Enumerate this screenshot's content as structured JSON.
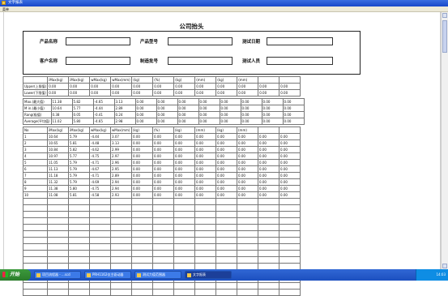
{
  "window": {
    "title": "文字报表"
  },
  "menu": {
    "item": "菜单"
  },
  "report": {
    "company_title": "公司抬头"
  },
  "form": {
    "product_name": "产品名称",
    "product_model": "产品型号",
    "test_date": "测试日期",
    "customer_name": "客户名称",
    "batch_no": "制造批号",
    "tester": "测试人员"
  },
  "header_row": [
    "",
    "iMax(kg)",
    "iMax(kg)",
    "wMax(kg)",
    "wMax(mm)",
    "(kg)",
    "(%)",
    "(kg)",
    "(mm)",
    "(kg)",
    "(mm)",
    "",
    ""
  ],
  "limit_rows": [
    [
      "Upper(上限值)",
      "0.00",
      "0.00",
      "0.00",
      "0.00",
      "0.00",
      "0.00",
      "0.00",
      "0.00",
      "0.00",
      "0.00",
      "0.00",
      "0.00"
    ],
    [
      "Lower(下限值)",
      "0.00",
      "0.00",
      "0.00",
      "0.00",
      "0.00",
      "0.00",
      "0.00",
      "0.00",
      "0.00",
      "0.00",
      "0.00",
      "0.00"
    ]
  ],
  "stat_rows": [
    [
      "Max.(最大值)",
      "11.38",
      "5.82",
      "-4.65",
      "3.13",
      "0.00",
      "0.00",
      "0.00",
      "0.00",
      "0.00",
      "0.00",
      "0.00",
      "0.00"
    ],
    [
      "M in.(最小值)",
      "10.64",
      "5.77",
      "-4.44",
      "2.89",
      "0.00",
      "0.00",
      "0.00",
      "0.00",
      "0.00",
      "0.00",
      "0.00",
      "0.00"
    ],
    [
      "Rang(极值)",
      "0.38",
      "0.05",
      "-0.41",
      "0.24",
      "0.00",
      "0.00",
      "0.00",
      "0.00",
      "0.00",
      "0.00",
      "0.00",
      "0.00"
    ],
    [
      "Average(平均值)",
      "11.02",
      "5.80",
      "-4.65",
      "2.98",
      "0.00",
      "0.00",
      "0.00",
      "0.00",
      "0.00",
      "0.00",
      "0.00",
      "0.00"
    ]
  ],
  "data_header": [
    "No",
    "iMax(kg)",
    "iMax(kg)",
    "wMax(kg)",
    "wMax(mm)",
    "(kg)",
    "(%)",
    "(kg)",
    "(mm)",
    "(kg)",
    "(mm)",
    "",
    ""
  ],
  "data_rows": [
    [
      "1",
      "10.64",
      "5.79",
      "-4.44",
      "3.07",
      "0.00",
      "0.00",
      "0.00",
      "0.00",
      "0.00",
      "0.00",
      "0.00",
      "0.00"
    ],
    [
      "2",
      "10.65",
      "5.81",
      "-4.48",
      "3.13",
      "0.00",
      "0.00",
      "0.00",
      "0.00",
      "0.00",
      "0.00",
      "0.00",
      "0.00"
    ],
    [
      "3",
      "10.84",
      "5.82",
      "-4.62",
      "2.99",
      "0.00",
      "0.00",
      "0.00",
      "0.00",
      "0.00",
      "0.00",
      "0.00",
      "0.00"
    ],
    [
      "4",
      "10.97",
      "5.77",
      "-4.75",
      "2.97",
      "0.00",
      "0.00",
      "0.00",
      "0.00",
      "0.00",
      "0.00",
      "0.00",
      "0.00"
    ],
    [
      "5",
      "11.05",
      "5.79",
      "-4.71",
      "2.96",
      "0.00",
      "0.00",
      "0.00",
      "0.00",
      "0.00",
      "0.00",
      "0.00",
      "0.00"
    ],
    [
      "6",
      "11.13",
      "5.79",
      "-4.67",
      "2.95",
      "0.00",
      "0.00",
      "0.00",
      "0.00",
      "0.00",
      "0.00",
      "0.00",
      "0.00"
    ],
    [
      "7",
      "11.18",
      "5.79",
      "-4.71",
      "2.89",
      "0.00",
      "0.00",
      "0.00",
      "0.00",
      "0.00",
      "0.00",
      "0.00",
      "0.00"
    ],
    [
      "8",
      "11.32",
      "5.79",
      "-4.69",
      "2.94",
      "0.00",
      "0.00",
      "0.00",
      "0.00",
      "0.00",
      "0.00",
      "0.00",
      "0.00"
    ],
    [
      "9",
      "11.38",
      "5.80",
      "-4.75",
      "2.94",
      "0.00",
      "0.00",
      "0.00",
      "0.00",
      "0.00",
      "0.00",
      "0.00",
      "0.00"
    ],
    [
      "10",
      "11.08",
      "5.81",
      "-4.58",
      "2.93",
      "0.00",
      "0.00",
      "0.00",
      "0.00",
      "0.00",
      "0.00",
      "0.00",
      "0.00"
    ]
  ],
  "empty_row_count": 15,
  "taskbar": {
    "start": "开始",
    "items": [
      "项目流程器 - ...scd",
      "PRH1162仪主驱动器",
      "测试力值范围器",
      "文字报表"
    ],
    "clock": "14:03"
  },
  "colors": {
    "titlebar": "#2456d8",
    "taskbar": "#245edb",
    "start": "#379237"
  },
  "icons": [
    "app-icon",
    "windows-logo-icon",
    "taskbar-app-icon"
  ]
}
